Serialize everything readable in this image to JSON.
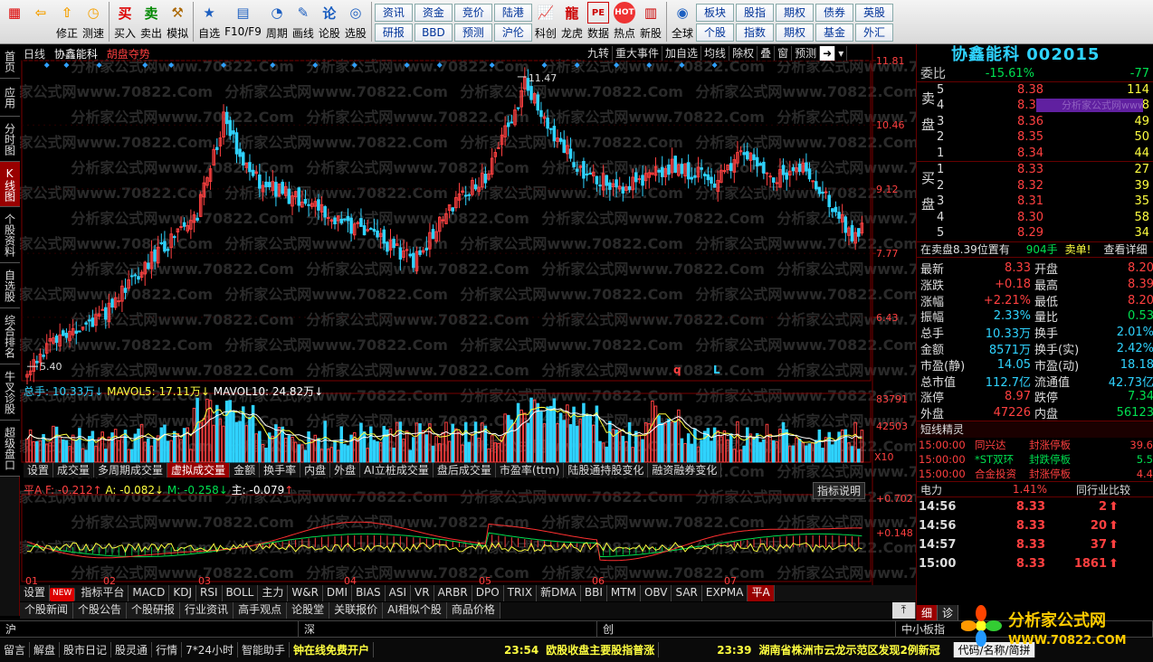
{
  "toolbar": {
    "big_buttons": [
      {
        "label": "",
        "icon": "app-grid-icon",
        "color": "#d00"
      },
      {
        "label": "",
        "icon": "back-arrow-icon",
        "color": "#f5a000"
      },
      {
        "label": "修正",
        "icon": "refresh-up-icon",
        "color": "#f5a000"
      },
      {
        "label": "测速",
        "icon": "speed-clock-icon",
        "color": "#f5a000"
      },
      {
        "label": "买入",
        "icon": "buy-icon",
        "text": "买",
        "color": "#d00"
      },
      {
        "label": "卖出",
        "icon": "sell-icon",
        "text": "卖",
        "color": "#080"
      },
      {
        "label": "模拟",
        "icon": "hammer-icon",
        "color": "#a60"
      },
      {
        "label": "自选",
        "icon": "star-icon",
        "color": "#1b5ec0"
      },
      {
        "label": "F10/F9",
        "icon": "f10-icon",
        "color": "#1b5ec0"
      },
      {
        "label": "周期",
        "icon": "clock-icon",
        "color": "#1b5ec0"
      },
      {
        "label": "画线",
        "icon": "pen-icon",
        "color": "#1b5ec0"
      },
      {
        "label": "论股",
        "icon": "discuss-icon",
        "text": "论",
        "color": "#1b5ec0"
      },
      {
        "label": "选股",
        "icon": "select-stock-icon",
        "color": "#1b5ec0"
      }
    ],
    "small_buttons": [
      [
        "资讯",
        "研报"
      ],
      [
        "资金",
        "BBD"
      ],
      [
        "竞价",
        "预测"
      ],
      [
        "陆港",
        "沪伦"
      ]
    ],
    "icon_buttons": [
      {
        "label": "科创",
        "icon": "chart-icon"
      },
      {
        "label": "龙虎",
        "icon": "dragon-icon"
      },
      {
        "label": "数据",
        "icon": "pe-icon",
        "text": "PE"
      },
      {
        "label": "热点",
        "icon": "hot-icon",
        "text": "HOT"
      },
      {
        "label": "新股",
        "icon": "new-stock-icon"
      },
      {
        "label": "全球",
        "icon": "globe-icon"
      }
    ],
    "right_buttons": [
      [
        "板块",
        "个股"
      ],
      [
        "股指",
        "指数"
      ],
      [
        "期权",
        "期权"
      ],
      [
        "债券",
        "基金"
      ],
      [
        "英股",
        "外汇"
      ]
    ]
  },
  "sidebar": [
    {
      "label": "首页",
      "active": false,
      "h": 38
    },
    {
      "label": "应用",
      "active": false,
      "h": 42
    },
    {
      "label": "分时图",
      "active": false,
      "h": 50
    },
    {
      "label": "K线图",
      "active": true,
      "h": 50
    },
    {
      "label": "个股资料",
      "active": false,
      "h": 62
    },
    {
      "label": "自选股",
      "active": false,
      "h": 50
    },
    {
      "label": "综合排名",
      "active": false,
      "h": 62
    },
    {
      "label": "牛叉诊股",
      "active": false,
      "h": 62
    },
    {
      "label": "超级盘口",
      "active": false,
      "h": 62
    }
  ],
  "chart_header": {
    "period": "日线",
    "stock_name": "协鑫能科",
    "indicator": "胡盘夺势",
    "menu": [
      "九转",
      "重大事件",
      "加自选",
      "均线",
      "除权",
      "叠",
      "窗",
      "预测"
    ]
  },
  "chart_data": {
    "type": "candlestick",
    "price_axis": [
      "11.81",
      "10.46",
      "9.12",
      "7.77",
      "6.43"
    ],
    "price_range": [
      5.1,
      11.81
    ],
    "high_label": "11.47",
    "low_label": "5.40",
    "marks": [
      "q",
      "L"
    ],
    "volume_legend": {
      "total_label": "总手: 10.33万",
      "mavol5_label": "MAVOL5: 17.11万",
      "mavol10_label": "MAVOL10: 24.82万"
    },
    "volume_axis": [
      "83791",
      "42503"
    ],
    "volume_unit": "X10",
    "indicator_legend": {
      "pf": "平A F: -0.212",
      "a": "A: -0.082",
      "m": "M: -0.258",
      "zhu": "主: -0.079"
    },
    "indicator_axis": [
      "+0.702",
      "+0.148"
    ],
    "months": [
      "01",
      "02",
      "03",
      "04",
      "05",
      "06",
      "07"
    ],
    "seed": 2015
  },
  "volume_tabs": [
    "设置",
    "成交量",
    "多周期成交量",
    "虚拟成交量",
    "金额",
    "换手率",
    "内盘",
    "外盘",
    "AI立桩成交量",
    "盘后成交量",
    "市盈率(ttm)",
    "陆股通持股变化",
    "融资融券变化"
  ],
  "volume_tab_active": 3,
  "indicator_help": "指标说明",
  "indicator_tabs": [
    "设置",
    "指标平台",
    "MACD",
    "KDJ",
    "RSI",
    "BOLL",
    "主力",
    "W&R",
    "DMI",
    "BIAS",
    "ASI",
    "VR",
    "ARBR",
    "DPO",
    "TRIX",
    "新DMA",
    "BBI",
    "MTM",
    "OBV",
    "SAR",
    "EXPMA",
    "平A"
  ],
  "indicator_tab_active": 21,
  "new_badge": "NEW",
  "news_tabs": [
    "个股新闻",
    "个股公告",
    "个股研报",
    "行业资讯",
    "高手观点",
    "论股堂",
    "关联报价",
    "AI相似个股",
    "商品价格"
  ],
  "index_bar": [
    "沪",
    "深",
    "创",
    "中小板指"
  ],
  "status_bar": {
    "items": [
      "留言",
      "解盘",
      "股市日记",
      "股灵通",
      "行情",
      "7*24小时",
      "智能助手"
    ],
    "scroll1": "钟在线免费开户",
    "news1_time": "23:54",
    "news1": "欧股收盘主要股指普涨",
    "news2_time": "23:39",
    "news2": "湖南省株洲市云龙示范区发现2例新冠",
    "search_label": "代码/名称/简拼"
  },
  "right_panel": {
    "title": "协鑫能科 002015",
    "weibi_label": "委比",
    "weibi": "-15.61%",
    "weicha": "-77",
    "sell_label": "卖盘",
    "buy_label": "买盘",
    "sells": [
      {
        "n": "5",
        "price": "8.38",
        "vol": "114"
      },
      {
        "n": "4",
        "price": "8.37",
        "vol": "28"
      },
      {
        "n": "3",
        "price": "8.36",
        "vol": "49"
      },
      {
        "n": "2",
        "price": "8.35",
        "vol": "50"
      },
      {
        "n": "1",
        "price": "8.34",
        "vol": "44"
      }
    ],
    "buys": [
      {
        "n": "1",
        "price": "8.33",
        "vol": "27"
      },
      {
        "n": "2",
        "price": "8.32",
        "vol": "39"
      },
      {
        "n": "3",
        "price": "8.31",
        "vol": "35"
      },
      {
        "n": "4",
        "price": "8.30",
        "vol": "58"
      },
      {
        "n": "5",
        "price": "8.29",
        "vol": "34"
      }
    ],
    "order_note": "在卖盘8.39位置有",
    "order_vol": "904手",
    "order_type": "卖单!",
    "order_detail": "查看详细",
    "stats": [
      [
        "最新",
        "8.33",
        "开盘",
        "8.20"
      ],
      [
        "涨跌",
        "+0.18",
        "最高",
        "8.39"
      ],
      [
        "涨幅",
        "+2.21%",
        "最低",
        "8.20"
      ],
      [
        "振幅",
        "2.33%",
        "量比",
        "0.53"
      ],
      [
        "总手",
        "10.33万",
        "换手",
        "2.01%"
      ],
      [
        "金额",
        "8571万",
        "换手(实)",
        "2.42%"
      ],
      [
        "市盈(静)",
        "14.05",
        "市盈(动)",
        "18.18"
      ],
      [
        "总市值",
        "112.7亿",
        "流通值",
        "42.73亿"
      ],
      [
        "涨停",
        "8.97",
        "跌停",
        "7.34"
      ],
      [
        "外盘",
        "47226",
        "内盘",
        "56123"
      ]
    ],
    "short_title": "短线精灵",
    "short_items": [
      {
        "time": "15:00:00",
        "name": "同兴达",
        "event": "封涨停板",
        "val": "39.6"
      },
      {
        "time": "15:00:00",
        "name": "*ST双环",
        "event": "封跌停板",
        "val": "5.5"
      },
      {
        "time": "15:00:00",
        "name": "合金投资",
        "event": "封涨停板",
        "val": "4.4"
      }
    ],
    "sector_label": "电力",
    "sector_pct": "1.41%",
    "sector_compare": "同行业比较",
    "ticks": [
      {
        "time": "14:56",
        "price": "8.33",
        "vol": "2",
        "dir": "up"
      },
      {
        "time": "14:56",
        "price": "8.33",
        "vol": "20",
        "dir": "up"
      },
      {
        "time": "14:57",
        "price": "8.33",
        "vol": "37",
        "dir": "up"
      },
      {
        "time": "15:00",
        "price": "8.33",
        "vol": "1861",
        "dir": "up"
      }
    ],
    "tick_tabs": [
      "细",
      "诊"
    ]
  },
  "watermark": "分析家公式网www.70822.Com",
  "logo": {
    "name": "分析家公式网",
    "url": "WWW.70822.COM"
  },
  "colors": {
    "up": "#ff4040",
    "down": "#2fd3ff",
    "grid": "#7a0000",
    "accent": "#900000"
  }
}
